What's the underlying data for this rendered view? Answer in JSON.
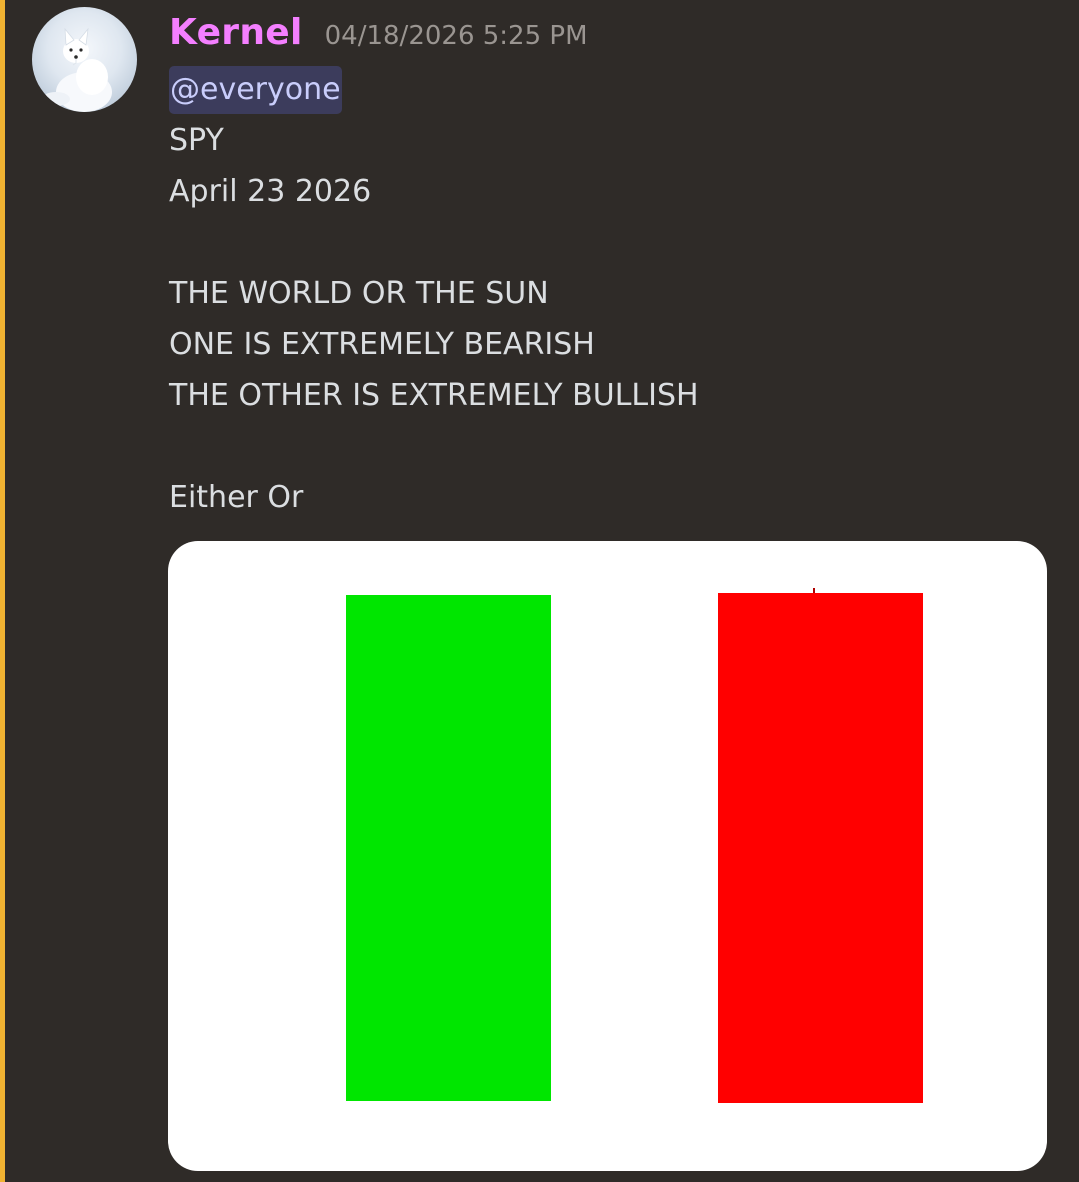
{
  "message": {
    "author": {
      "name": "Kernel",
      "name_color": "#f47fff",
      "avatar": "arctic-fox-avatar"
    },
    "timestamp": "04/18/2026 5:25 PM",
    "mention": "@everyone",
    "lines": [
      "SPY",
      "April 23 2026",
      "",
      "THE WORLD OR THE SUN",
      "ONE IS EXTREMELY BEARISH",
      "THE OTHER IS EXTREMELY BULLISH",
      "",
      "Either Or"
    ],
    "highlight_color": "#f0b232",
    "attachment": {
      "kind": "image",
      "background": "#ffffff",
      "candles": [
        {
          "color": "#00e600",
          "direction": "bullish"
        },
        {
          "color": "#ff0000",
          "direction": "bearish"
        }
      ]
    }
  }
}
